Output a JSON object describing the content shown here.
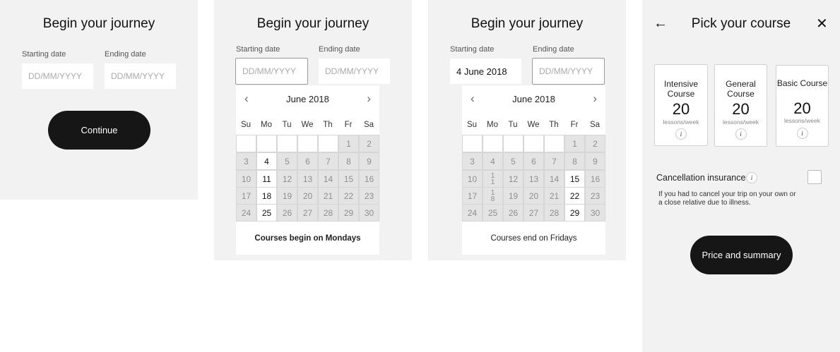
{
  "screen1": {
    "title": "Begin your journey",
    "start_label": "Starting date",
    "end_label": "Ending date",
    "start_placeholder": "DD/MM/YYYY",
    "end_placeholder": "DD/MM/YYYY",
    "continue_label": "Continue"
  },
  "screen2": {
    "title": "Begin your journey",
    "start_label": "Starting date",
    "end_label": "Ending date",
    "start_placeholder": "DD/MM/YYYY",
    "end_placeholder": "DD/MM/YYYY",
    "calendar": {
      "month": "June 2018",
      "weekdays": [
        "Su",
        "Mo",
        "Tu",
        "We",
        "Th",
        "Fr",
        "Sa"
      ],
      "weeks": [
        [
          "",
          "",
          "",
          "",
          "",
          "1",
          "2"
        ],
        [
          "3",
          "4",
          "5",
          "6",
          "7",
          "8",
          "9"
        ],
        [
          "10",
          "11",
          "12",
          "13",
          "14",
          "15",
          "16"
        ],
        [
          "17",
          "18",
          "19",
          "20",
          "21",
          "22",
          "23"
        ],
        [
          "24",
          "25",
          "26",
          "27",
          "28",
          "29",
          "30"
        ]
      ],
      "available_days": [
        "4",
        "11",
        "18",
        "25"
      ],
      "note": "Courses begin on Mondays"
    }
  },
  "screen3": {
    "title": "Begin your journey",
    "start_label": "Starting date",
    "end_label": "Ending date",
    "start_value": "4 June 2018",
    "end_placeholder": "DD/MM/YYYY",
    "calendar": {
      "month": "June 2018",
      "weekdays": [
        "Su",
        "Mo",
        "Tu",
        "We",
        "Th",
        "Fr",
        "Sa"
      ],
      "weeks": [
        [
          "",
          "",
          "",
          "",
          "",
          "1",
          "2"
        ],
        [
          "3",
          "4",
          "5",
          "6",
          "7",
          "8",
          "9"
        ],
        [
          "10",
          "1|1",
          "12",
          "13",
          "14",
          "15",
          "16"
        ],
        [
          "17",
          "1|8",
          "19",
          "20",
          "21",
          "22",
          "23"
        ],
        [
          "24",
          "25",
          "26",
          "27",
          "28",
          "29",
          "30"
        ]
      ],
      "available_days": [
        "15",
        "22",
        "29"
      ],
      "note": "Courses end on Fridays"
    }
  },
  "screen4": {
    "title": "Pick your course",
    "back_icon": "arrow-left-icon",
    "close_icon": "close-icon",
    "courses": [
      {
        "name": "Intensive Course",
        "lessons": "20",
        "unit": "lessons/week",
        "info": "i"
      },
      {
        "name": "General Course",
        "lessons": "20",
        "unit": "lessons/week",
        "info": "i"
      },
      {
        "name": "Basic Course",
        "lessons": "20",
        "unit": "lessons/week",
        "info": "i"
      }
    ],
    "insurance_label": "Cancellation insurance",
    "insurance_info": "i",
    "insurance_desc": "If you had to cancel your trip on your own or a close relative due to illness.",
    "button_label": "Price and summary"
  }
}
